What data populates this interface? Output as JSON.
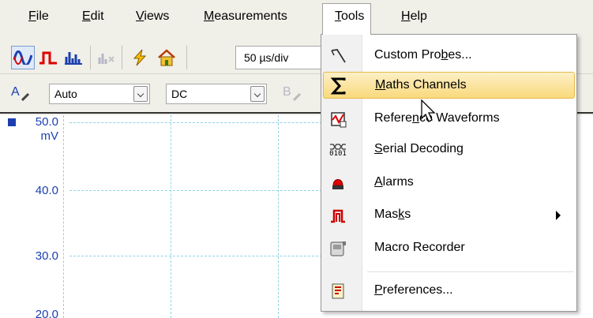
{
  "menubar": {
    "items": [
      {
        "label": "File",
        "ul": "F",
        "rest": "ile"
      },
      {
        "label": "Edit",
        "ul": "E",
        "rest": "dit"
      },
      {
        "label": "Views",
        "ul": "V",
        "rest": "iews"
      },
      {
        "label": "Measurements",
        "ul": "M",
        "rest": "easurements"
      },
      {
        "label": "Tools",
        "ul": "T",
        "rest": "ools"
      },
      {
        "label": "Help",
        "ul": "H",
        "rest": "elp"
      }
    ]
  },
  "toolbar": {
    "timebase": "50 µs/div"
  },
  "channels": {
    "a_label": "A",
    "a_range": "Auto",
    "a_coupling": "DC",
    "b_label": "B"
  },
  "scope": {
    "y_labels": [
      "50.0",
      "mV",
      "40.0",
      "30.0",
      "20.0"
    ]
  },
  "tools_menu": {
    "items": [
      {
        "pre": "Custom Pro",
        "ul": "b",
        "post": "es...",
        "icon": "custom-probes-icon"
      },
      {
        "pre": "",
        "ul": "M",
        "post": "aths Channels",
        "icon": "sigma-icon"
      },
      {
        "pre": "Refere",
        "ul": "n",
        "post": "ce Waveforms",
        "icon": "reference-waveform-icon"
      },
      {
        "pre": "",
        "ul": "S",
        "post": "erial Decoding",
        "icon": "serial-decoding-icon"
      },
      {
        "pre": "",
        "ul": "A",
        "post": "larms",
        "icon": "alarm-icon"
      },
      {
        "pre": "Mas",
        "ul": "k",
        "post": "s",
        "icon": "mask-icon"
      },
      {
        "pre": "Macro Recorder",
        "ul": "",
        "post": "",
        "icon": "macro-recorder-icon"
      },
      {
        "pre": "",
        "ul": "P",
        "post": "references...",
        "icon": "preferences-icon"
      }
    ],
    "serial_icon_text": "0101"
  }
}
